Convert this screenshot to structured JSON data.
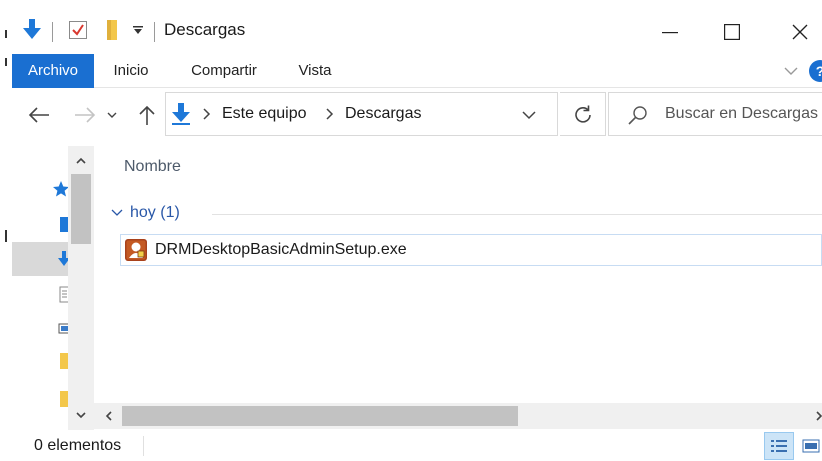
{
  "window": {
    "title": "Descargas"
  },
  "ribbon": {
    "tabs": [
      "Archivo",
      "Inicio",
      "Compartir",
      "Vista"
    ],
    "active_tab": "Archivo",
    "accent": "#1a6fd1"
  },
  "nav": {
    "breadcrumb": [
      "Este equipo",
      "Descargas"
    ],
    "search_placeholder": "Buscar en Descargas"
  },
  "content": {
    "column_header": "Nombre",
    "group_label": "hoy (1)",
    "files": [
      {
        "name": "DRMDesktopBasicAdminSetup.exe",
        "icon": "installer-app-icon"
      }
    ]
  },
  "status": {
    "item_count": "0 elementos"
  },
  "icons": {
    "download": "down-arrow-icon",
    "properties": "checkbox-icon",
    "folder": "folder-icon",
    "search": "search-icon",
    "refresh": "refresh-icon"
  }
}
